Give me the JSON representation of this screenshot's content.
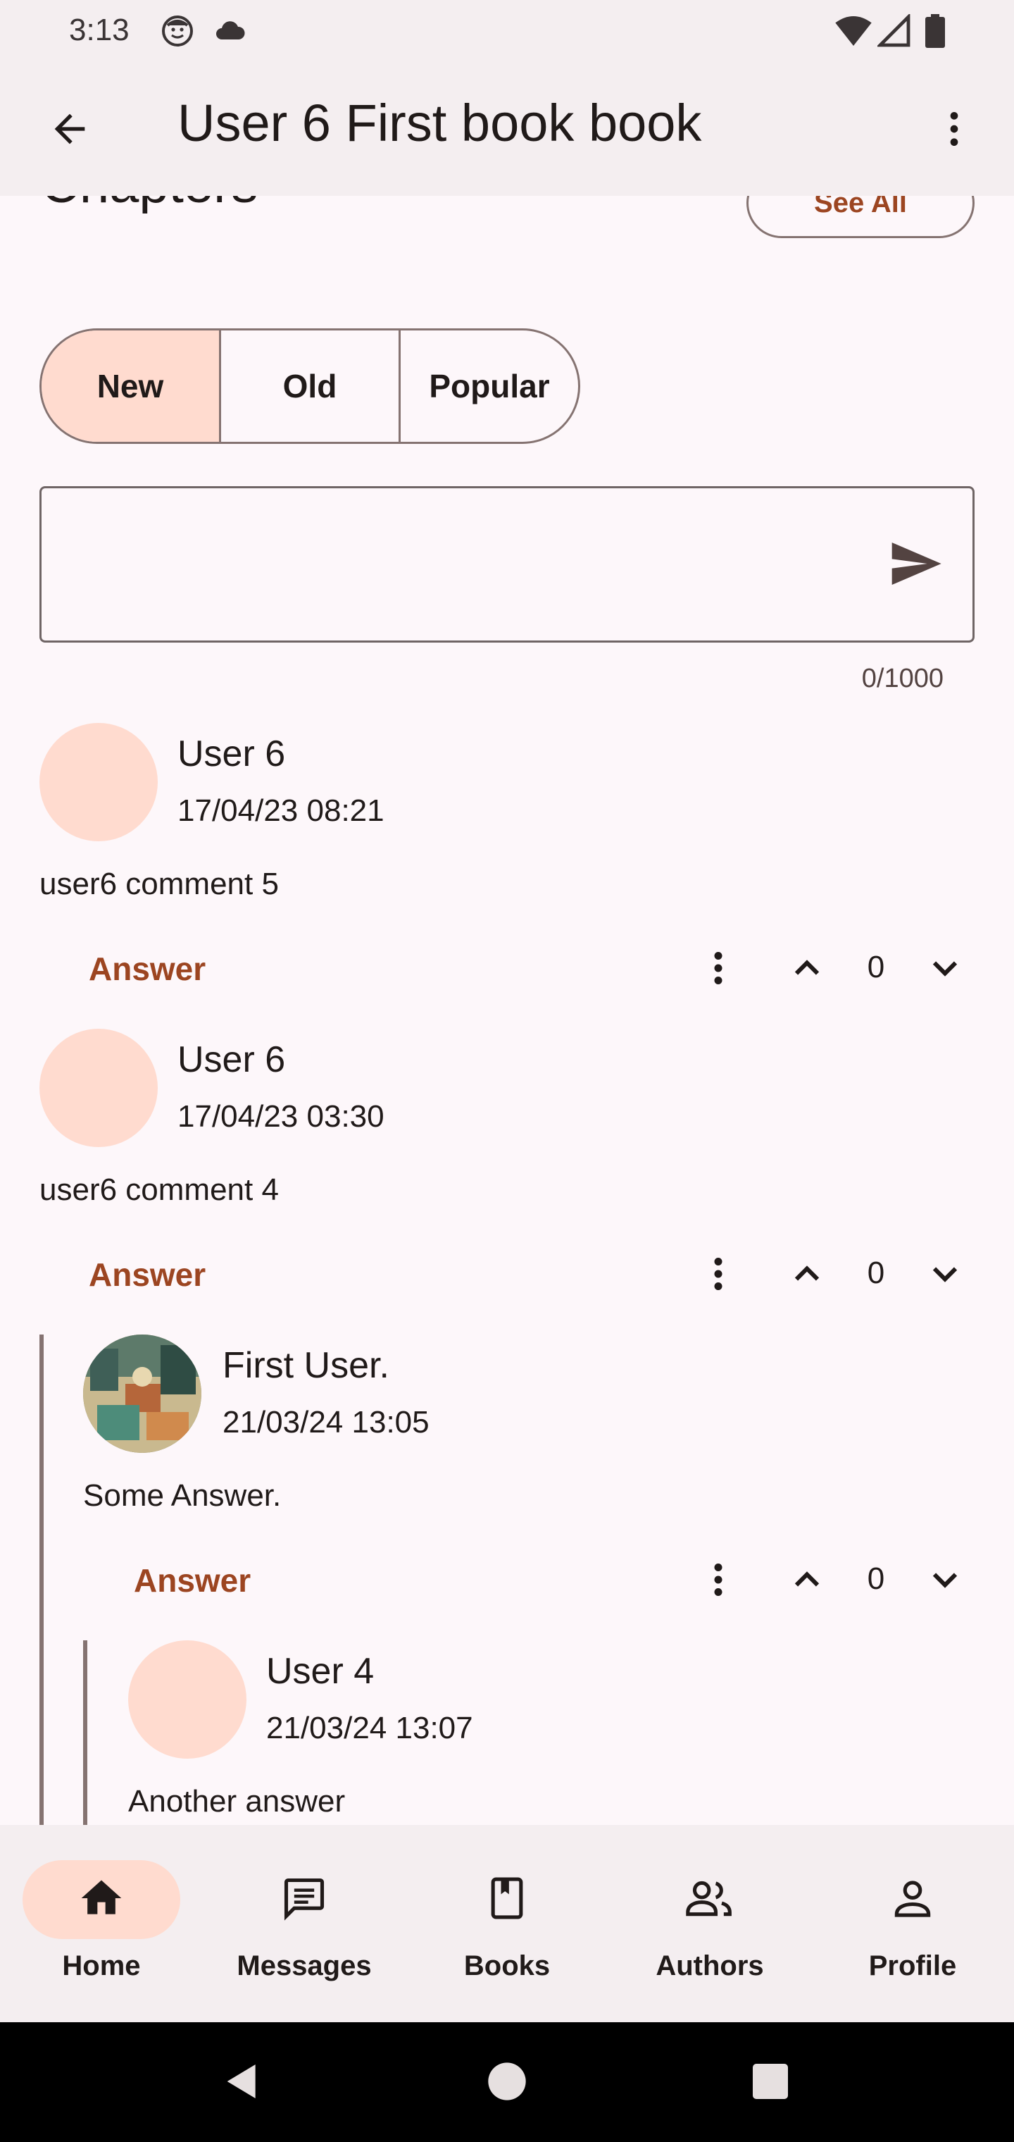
{
  "status_bar": {
    "time": "3:13",
    "icons": [
      "face-icon",
      "cloud-icon",
      "wifi-icon",
      "signal-icon",
      "battery-icon"
    ]
  },
  "app_bar": {
    "title": "User 6 First book book",
    "back_icon": "arrow-back-icon",
    "more_icon": "more-vert-icon"
  },
  "section": {
    "title": "Chapters",
    "see_all_label": "See All"
  },
  "sort_tabs": {
    "options": [
      "New",
      "Old",
      "Popular"
    ],
    "selected": "New"
  },
  "comment_input": {
    "value": "",
    "placeholder": "",
    "counter": "0/1000",
    "send_icon": "send-icon"
  },
  "comments": [
    {
      "user": "User 6",
      "date": "17/04/23 08:21",
      "text": "user6 comment 5",
      "answer_label": "Answer",
      "votes": "0"
    },
    {
      "user": "User 6",
      "date": "17/04/23 03:30",
      "text": "user6 comment 4",
      "answer_label": "Answer",
      "votes": "0"
    },
    {
      "user": "First User.",
      "date": "21/03/24 13:05",
      "text": "Some Answer.",
      "answer_label": "Answer",
      "votes": "0"
    },
    {
      "user": "User 4",
      "date": "21/03/24 13:07",
      "text": "Another answer"
    }
  ],
  "bottom_nav": {
    "items": [
      {
        "label": "Home",
        "icon": "home-icon",
        "active": true
      },
      {
        "label": "Messages",
        "icon": "messages-icon",
        "active": false
      },
      {
        "label": "Books",
        "icon": "book-icon",
        "active": false
      },
      {
        "label": "Authors",
        "icon": "people-icon",
        "active": false
      },
      {
        "label": "Profile",
        "icon": "person-icon",
        "active": false
      }
    ]
  },
  "colors": {
    "accent": "#9c4521",
    "selected_container": "#ffdbcf",
    "surface": "#fdf7fa",
    "bar_surface": "#f4eef0",
    "outline": "#857371"
  }
}
